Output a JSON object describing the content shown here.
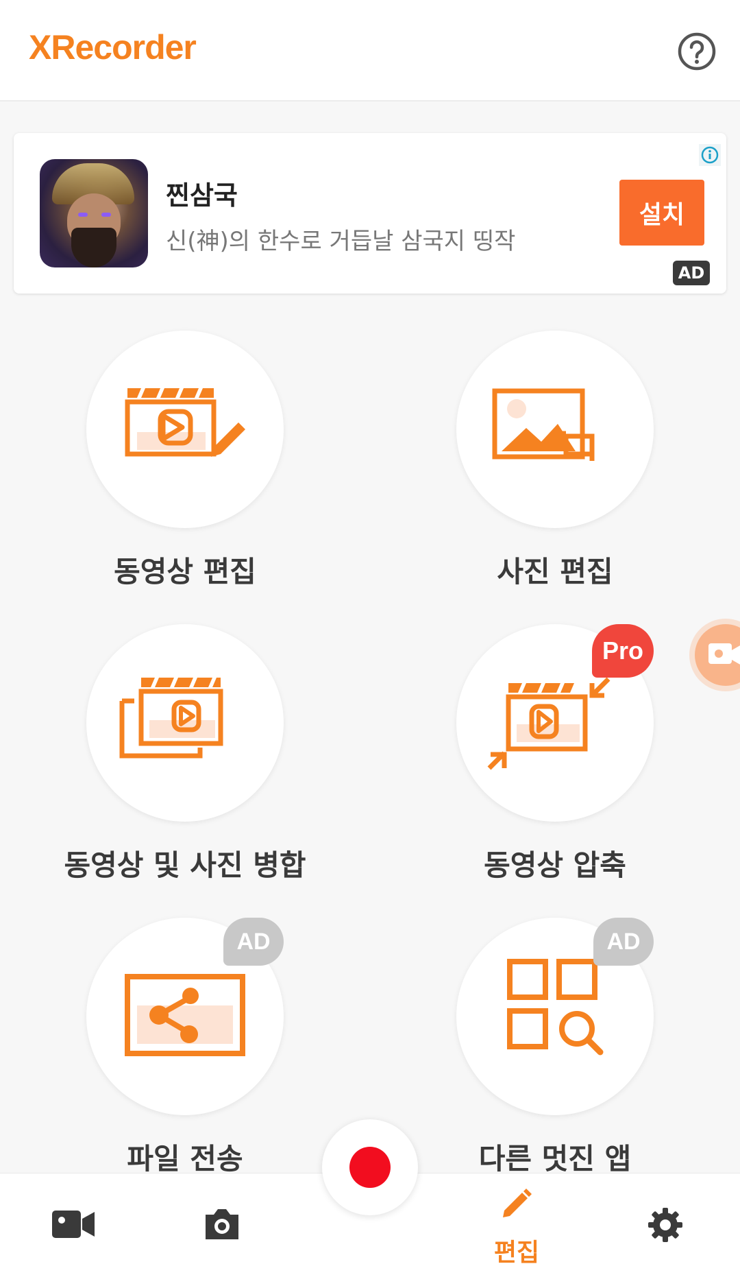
{
  "header": {
    "app_title": "XRecorder",
    "help_icon": "help-circle-icon"
  },
  "ad": {
    "title": "찐삼국",
    "description": "신(神)의 한수로 거듭날 삼국지 띵작",
    "install_label": "설치",
    "ad_badge": "AD",
    "info_icon": "info-icon"
  },
  "tiles": [
    {
      "label": "동영상 편집",
      "icon": "video-edit-icon"
    },
    {
      "label": "사진 편집",
      "icon": "photo-edit-icon"
    },
    {
      "label": "동영상 및 사진 병합",
      "icon": "merge-icon"
    },
    {
      "label": "동영상 압축",
      "icon": "compress-icon",
      "badge": "Pro"
    },
    {
      "label": "파일 전송",
      "icon": "share-file-icon",
      "badge": "AD"
    },
    {
      "label": "다른 멋진 앱",
      "icon": "apps-search-icon",
      "badge": "AD"
    }
  ],
  "bottom_nav": {
    "items": [
      {
        "name": "video",
        "icon": "video-camera-icon"
      },
      {
        "name": "screenshot",
        "icon": "camera-icon"
      },
      {
        "name": "edit",
        "icon": "pencil-icon",
        "label": "편집",
        "active": true
      },
      {
        "name": "settings",
        "icon": "gear-icon"
      }
    ]
  },
  "colors": {
    "accent": "#f58220",
    "install_button": "#f96c2c",
    "pro_badge": "#f0463c",
    "record": "#f20d1f"
  }
}
